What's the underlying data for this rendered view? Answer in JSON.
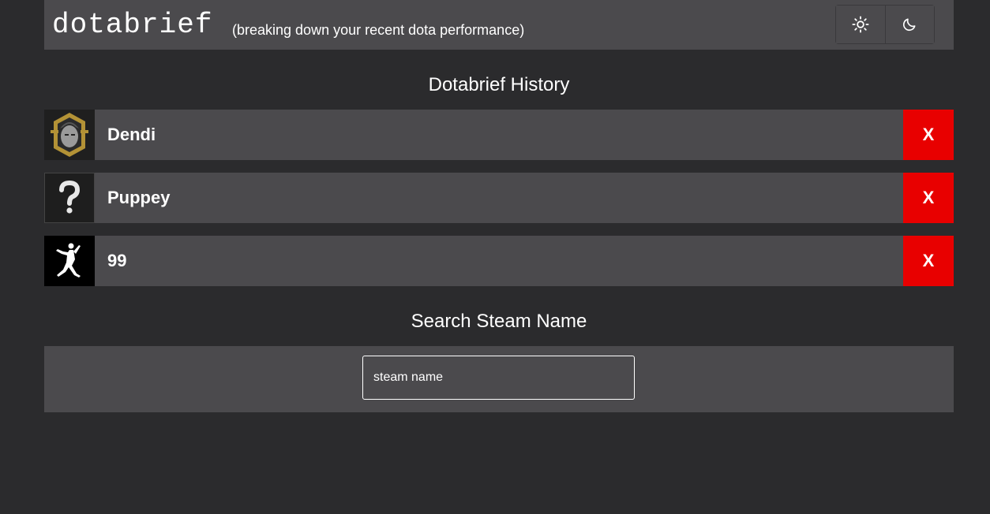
{
  "header": {
    "logo": "dotabrief",
    "tagline": "(breaking down your recent dota performance)",
    "theme_light_icon": "sun-icon",
    "theme_dark_icon": "moon-icon"
  },
  "history": {
    "title": "Dotabrief History",
    "items": [
      {
        "name": "Dendi",
        "avatar": "dendi-avatar",
        "remove_label": "X"
      },
      {
        "name": "Puppey",
        "avatar": "question-mark-avatar",
        "remove_label": "X"
      },
      {
        "name": "99",
        "avatar": "jumpman-avatar",
        "remove_label": "X"
      }
    ]
  },
  "search": {
    "title": "Search Steam Name",
    "placeholder": "steam name"
  },
  "colors": {
    "background": "#2b2b2d",
    "panel": "#4b4a4d",
    "remove": "#e80000",
    "text": "#ffffff"
  }
}
